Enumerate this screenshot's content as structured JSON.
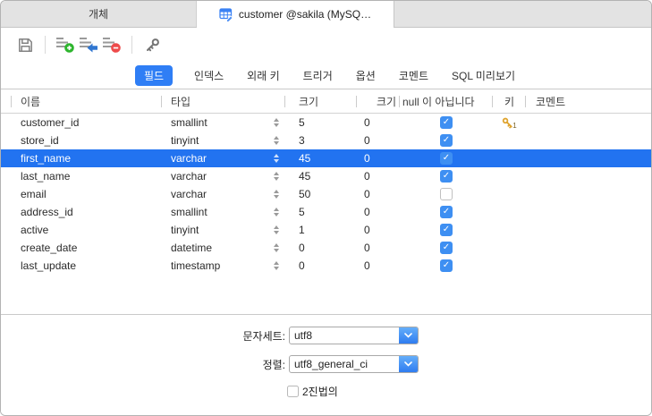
{
  "tab_bar": {
    "objects_tab": "개체",
    "active_tab": "customer @sakila (MySQ…"
  },
  "toolbar": {
    "icons": [
      "save-icon",
      "add-field-icon",
      "insert-field-icon",
      "delete-field-icon",
      "key-icon"
    ]
  },
  "view_tabs": [
    {
      "label": "필드",
      "active": true
    },
    {
      "label": "인덱스",
      "active": false
    },
    {
      "label": "외래 키",
      "active": false
    },
    {
      "label": "트리거",
      "active": false
    },
    {
      "label": "옵션",
      "active": false
    },
    {
      "label": "코멘트",
      "active": false
    },
    {
      "label": "SQL 미리보기",
      "active": false
    }
  ],
  "grid": {
    "columns": [
      "이름",
      "타입",
      "크기",
      "크기",
      "null 이 아닙니다",
      "키",
      "코멘트"
    ],
    "rows": [
      {
        "name": "customer_id",
        "type": "smallint",
        "size": "5",
        "size2": "0",
        "not_null": true,
        "key": "1",
        "comment": "",
        "selected": false
      },
      {
        "name": "store_id",
        "type": "tinyint",
        "size": "3",
        "size2": "0",
        "not_null": true,
        "key": "",
        "comment": "",
        "selected": false
      },
      {
        "name": "first_name",
        "type": "varchar",
        "size": "45",
        "size2": "0",
        "not_null": true,
        "key": "",
        "comment": "",
        "selected": true
      },
      {
        "name": "last_name",
        "type": "varchar",
        "size": "45",
        "size2": "0",
        "not_null": true,
        "key": "",
        "comment": "",
        "selected": false
      },
      {
        "name": "email",
        "type": "varchar",
        "size": "50",
        "size2": "0",
        "not_null": false,
        "key": "",
        "comment": "",
        "selected": false
      },
      {
        "name": "address_id",
        "type": "smallint",
        "size": "5",
        "size2": "0",
        "not_null": true,
        "key": "",
        "comment": "",
        "selected": false
      },
      {
        "name": "active",
        "type": "tinyint",
        "size": "1",
        "size2": "0",
        "not_null": true,
        "key": "",
        "comment": "",
        "selected": false
      },
      {
        "name": "create_date",
        "type": "datetime",
        "size": "0",
        "size2": "0",
        "not_null": true,
        "key": "",
        "comment": "",
        "selected": false
      },
      {
        "name": "last_update",
        "type": "timestamp",
        "size": "0",
        "size2": "0",
        "not_null": true,
        "key": "",
        "comment": "",
        "selected": false
      }
    ]
  },
  "footer": {
    "charset_label": "문자세트:",
    "charset_value": "utf8",
    "collation_label": "정렬:",
    "collation_value": "utf8_general_ci",
    "binary_label": "2진법의",
    "binary_checked": false
  },
  "colors": {
    "accent_blue": "#2f7ef5",
    "selected_row": "#2273f0",
    "checkbox_blue": "#3e8ff2",
    "key_gold": "#dfa32d"
  }
}
